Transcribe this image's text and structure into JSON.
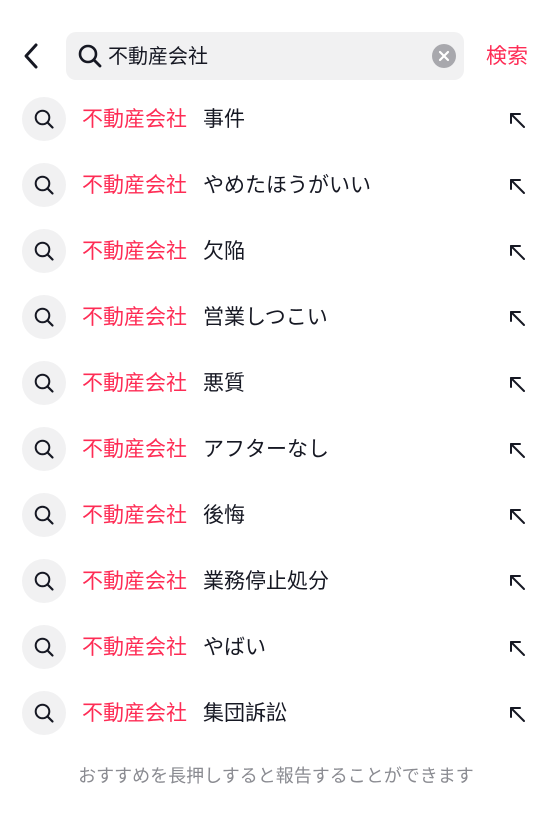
{
  "search": {
    "query": "不動産会社",
    "submit_label": "検索"
  },
  "icons": {
    "back": "chevron-left-icon",
    "search": "search-icon",
    "clear": "clear-icon",
    "fill": "arrow-up-left-icon"
  },
  "colors": {
    "accent": "#fe2c55",
    "text": "#161823",
    "muted": "#8a8b91",
    "field_bg": "#f1f1f2"
  },
  "suggestions": [
    {
      "highlight": "不動産会社",
      "rest": "事件"
    },
    {
      "highlight": "不動産会社",
      "rest": "やめたほうがいい"
    },
    {
      "highlight": "不動産会社",
      "rest": "欠陥"
    },
    {
      "highlight": "不動産会社",
      "rest": "営業しつこい"
    },
    {
      "highlight": "不動産会社",
      "rest": "悪質"
    },
    {
      "highlight": "不動産会社",
      "rest": "アフターなし"
    },
    {
      "highlight": "不動産会社",
      "rest": "後悔"
    },
    {
      "highlight": "不動産会社",
      "rest": "業務停止処分"
    },
    {
      "highlight": "不動産会社",
      "rest": "やばい"
    },
    {
      "highlight": "不動産会社",
      "rest": "集団訴訟"
    }
  ],
  "footer_note": "おすすめを長押しすると報告することができます"
}
